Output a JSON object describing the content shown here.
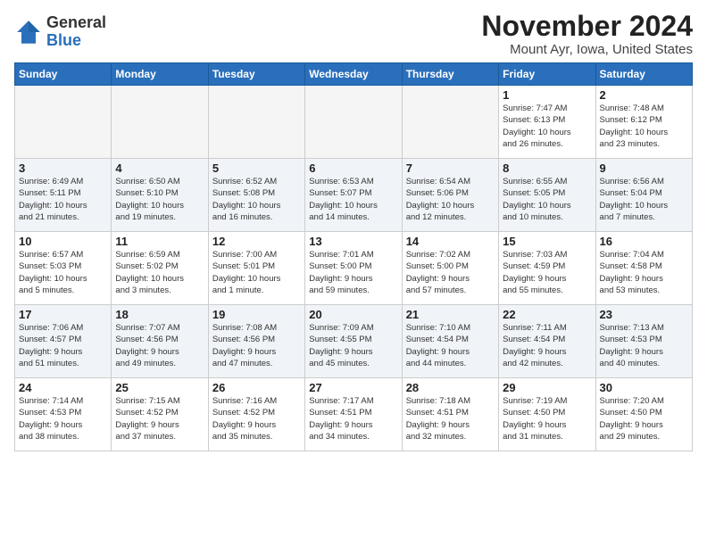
{
  "header": {
    "logo_general": "General",
    "logo_blue": "Blue",
    "month_title": "November 2024",
    "location": "Mount Ayr, Iowa, United States"
  },
  "days_of_week": [
    "Sunday",
    "Monday",
    "Tuesday",
    "Wednesday",
    "Thursday",
    "Friday",
    "Saturday"
  ],
  "weeks": [
    {
      "days": [
        {
          "num": "",
          "info": "",
          "empty": true
        },
        {
          "num": "",
          "info": "",
          "empty": true
        },
        {
          "num": "",
          "info": "",
          "empty": true
        },
        {
          "num": "",
          "info": "",
          "empty": true
        },
        {
          "num": "",
          "info": "",
          "empty": true
        },
        {
          "num": "1",
          "info": "Sunrise: 7:47 AM\nSunset: 6:13 PM\nDaylight: 10 hours\nand 26 minutes."
        },
        {
          "num": "2",
          "info": "Sunrise: 7:48 AM\nSunset: 6:12 PM\nDaylight: 10 hours\nand 23 minutes."
        }
      ]
    },
    {
      "days": [
        {
          "num": "3",
          "info": "Sunrise: 6:49 AM\nSunset: 5:11 PM\nDaylight: 10 hours\nand 21 minutes."
        },
        {
          "num": "4",
          "info": "Sunrise: 6:50 AM\nSunset: 5:10 PM\nDaylight: 10 hours\nand 19 minutes."
        },
        {
          "num": "5",
          "info": "Sunrise: 6:52 AM\nSunset: 5:08 PM\nDaylight: 10 hours\nand 16 minutes."
        },
        {
          "num": "6",
          "info": "Sunrise: 6:53 AM\nSunset: 5:07 PM\nDaylight: 10 hours\nand 14 minutes."
        },
        {
          "num": "7",
          "info": "Sunrise: 6:54 AM\nSunset: 5:06 PM\nDaylight: 10 hours\nand 12 minutes."
        },
        {
          "num": "8",
          "info": "Sunrise: 6:55 AM\nSunset: 5:05 PM\nDaylight: 10 hours\nand 10 minutes."
        },
        {
          "num": "9",
          "info": "Sunrise: 6:56 AM\nSunset: 5:04 PM\nDaylight: 10 hours\nand 7 minutes."
        }
      ]
    },
    {
      "days": [
        {
          "num": "10",
          "info": "Sunrise: 6:57 AM\nSunset: 5:03 PM\nDaylight: 10 hours\nand 5 minutes."
        },
        {
          "num": "11",
          "info": "Sunrise: 6:59 AM\nSunset: 5:02 PM\nDaylight: 10 hours\nand 3 minutes."
        },
        {
          "num": "12",
          "info": "Sunrise: 7:00 AM\nSunset: 5:01 PM\nDaylight: 10 hours\nand 1 minute."
        },
        {
          "num": "13",
          "info": "Sunrise: 7:01 AM\nSunset: 5:00 PM\nDaylight: 9 hours\nand 59 minutes."
        },
        {
          "num": "14",
          "info": "Sunrise: 7:02 AM\nSunset: 5:00 PM\nDaylight: 9 hours\nand 57 minutes."
        },
        {
          "num": "15",
          "info": "Sunrise: 7:03 AM\nSunset: 4:59 PM\nDaylight: 9 hours\nand 55 minutes."
        },
        {
          "num": "16",
          "info": "Sunrise: 7:04 AM\nSunset: 4:58 PM\nDaylight: 9 hours\nand 53 minutes."
        }
      ]
    },
    {
      "days": [
        {
          "num": "17",
          "info": "Sunrise: 7:06 AM\nSunset: 4:57 PM\nDaylight: 9 hours\nand 51 minutes."
        },
        {
          "num": "18",
          "info": "Sunrise: 7:07 AM\nSunset: 4:56 PM\nDaylight: 9 hours\nand 49 minutes."
        },
        {
          "num": "19",
          "info": "Sunrise: 7:08 AM\nSunset: 4:56 PM\nDaylight: 9 hours\nand 47 minutes."
        },
        {
          "num": "20",
          "info": "Sunrise: 7:09 AM\nSunset: 4:55 PM\nDaylight: 9 hours\nand 45 minutes."
        },
        {
          "num": "21",
          "info": "Sunrise: 7:10 AM\nSunset: 4:54 PM\nDaylight: 9 hours\nand 44 minutes."
        },
        {
          "num": "22",
          "info": "Sunrise: 7:11 AM\nSunset: 4:54 PM\nDaylight: 9 hours\nand 42 minutes."
        },
        {
          "num": "23",
          "info": "Sunrise: 7:13 AM\nSunset: 4:53 PM\nDaylight: 9 hours\nand 40 minutes."
        }
      ]
    },
    {
      "days": [
        {
          "num": "24",
          "info": "Sunrise: 7:14 AM\nSunset: 4:53 PM\nDaylight: 9 hours\nand 38 minutes."
        },
        {
          "num": "25",
          "info": "Sunrise: 7:15 AM\nSunset: 4:52 PM\nDaylight: 9 hours\nand 37 minutes."
        },
        {
          "num": "26",
          "info": "Sunrise: 7:16 AM\nSunset: 4:52 PM\nDaylight: 9 hours\nand 35 minutes."
        },
        {
          "num": "27",
          "info": "Sunrise: 7:17 AM\nSunset: 4:51 PM\nDaylight: 9 hours\nand 34 minutes."
        },
        {
          "num": "28",
          "info": "Sunrise: 7:18 AM\nSunset: 4:51 PM\nDaylight: 9 hours\nand 32 minutes."
        },
        {
          "num": "29",
          "info": "Sunrise: 7:19 AM\nSunset: 4:50 PM\nDaylight: 9 hours\nand 31 minutes."
        },
        {
          "num": "30",
          "info": "Sunrise: 7:20 AM\nSunset: 4:50 PM\nDaylight: 9 hours\nand 29 minutes."
        }
      ]
    }
  ]
}
